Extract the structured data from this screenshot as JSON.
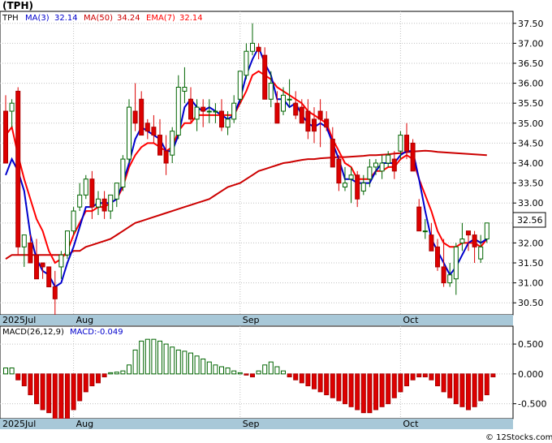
{
  "chart_data": {
    "type": "candlestick",
    "title": "(TPH)",
    "ticker": "TPH",
    "indicators": {
      "ma3": {
        "label": "MA(3)",
        "value": "32.14",
        "color": "#0000cc"
      },
      "ma50": {
        "label": "MA(50)",
        "value": "34.24",
        "color": "#cc0000"
      },
      "ema7": {
        "label": "EMA(7)",
        "value": "32.14",
        "color": "#ff0000"
      }
    },
    "price_axis": {
      "ylim": [
        30.2,
        37.8
      ],
      "ticks": [
        "37.50",
        "37.00",
        "36.50",
        "36.00",
        "35.50",
        "35.00",
        "34.50",
        "34.00",
        "33.50",
        "33.00",
        "32.50",
        "32.00",
        "31.50",
        "31.00",
        "30.50"
      ],
      "last_price_tag": "32.56"
    },
    "date_labels": [
      {
        "label": "2025Jul",
        "index": 0
      },
      {
        "label": "Aug",
        "index": 11
      },
      {
        "label": "Sep",
        "index": 38
      },
      {
        "label": "Oct",
        "index": 64
      }
    ],
    "candles": [
      [
        35.3,
        35.7,
        34.2,
        34.0
      ],
      [
        35.3,
        35.6,
        34.9,
        35.5
      ],
      [
        35.8,
        35.9,
        31.7,
        31.9
      ],
      [
        31.9,
        32.1,
        31.4,
        32.2
      ],
      [
        32.0,
        32.2,
        31.6,
        31.5
      ],
      [
        31.7,
        32.1,
        31.1,
        31.1
      ],
      [
        31.5,
        31.5,
        31.1,
        31.4
      ],
      [
        31.4,
        31.4,
        30.9,
        30.9
      ],
      [
        30.9,
        31.3,
        30.2,
        30.6
      ],
      [
        31.4,
        31.8,
        31.1,
        31.7
      ],
      [
        31.7,
        32.3,
        31.6,
        32.3
      ],
      [
        32.3,
        32.9,
        32.2,
        32.8
      ],
      [
        32.9,
        33.5,
        32.8,
        33.2
      ],
      [
        33.2,
        33.7,
        33.1,
        33.6
      ],
      [
        33.6,
        33.8,
        32.6,
        32.9
      ],
      [
        32.9,
        33.3,
        32.7,
        33.1
      ],
      [
        33.1,
        33.3,
        32.6,
        32.8
      ],
      [
        32.8,
        33.2,
        32.6,
        33.2
      ],
      [
        33.1,
        33.5,
        32.9,
        33.5
      ],
      [
        33.4,
        34.2,
        33.3,
        34.1
      ],
      [
        34.1,
        35.6,
        34.0,
        35.4
      ],
      [
        35.3,
        36.0,
        34.8,
        35.0
      ],
      [
        35.6,
        35.8,
        34.8,
        34.7
      ],
      [
        35.0,
        35.1,
        34.6,
        34.8
      ],
      [
        34.9,
        35.2,
        34.5,
        34.7
      ],
      [
        34.7,
        35.1,
        34.2,
        34.2
      ],
      [
        34.3,
        34.7,
        33.7,
        34.0
      ],
      [
        34.2,
        34.9,
        34.0,
        34.8
      ],
      [
        34.7,
        36.2,
        34.6,
        35.9
      ],
      [
        35.8,
        36.4,
        35.5,
        35.9
      ],
      [
        35.6,
        35.9,
        35.0,
        35.1
      ],
      [
        35.1,
        35.6,
        34.8,
        35.4
      ],
      [
        35.4,
        35.6,
        34.9,
        35.3
      ],
      [
        35.3,
        35.6,
        35.0,
        35.3
      ],
      [
        35.3,
        35.5,
        35.0,
        35.3
      ],
      [
        35.3,
        35.6,
        34.8,
        34.9
      ],
      [
        34.9,
        35.3,
        34.7,
        35.1
      ],
      [
        35.1,
        35.7,
        35.0,
        35.5
      ],
      [
        35.6,
        36.2,
        35.5,
        36.3
      ],
      [
        36.2,
        37.0,
        36.1,
        36.8
      ],
      [
        36.8,
        37.5,
        36.7,
        37.0
      ],
      [
        36.9,
        37.0,
        36.6,
        36.8
      ],
      [
        36.7,
        36.9,
        35.6,
        35.6
      ],
      [
        35.6,
        36.3,
        35.4,
        36.0
      ],
      [
        35.5,
        35.8,
        35.0,
        35.0
      ],
      [
        35.3,
        35.9,
        35.2,
        35.7
      ],
      [
        35.6,
        36.1,
        35.4,
        35.6
      ],
      [
        35.5,
        35.8,
        35.1,
        35.2
      ],
      [
        35.4,
        35.6,
        35.0,
        35.0
      ],
      [
        35.3,
        35.6,
        34.6,
        34.8
      ],
      [
        35.1,
        35.4,
        34.5,
        34.8
      ],
      [
        35.3,
        35.6,
        34.4,
        35.1
      ],
      [
        35.1,
        35.3,
        34.8,
        34.9
      ],
      [
        34.6,
        34.9,
        33.9,
        33.9
      ],
      [
        34.1,
        34.2,
        33.3,
        33.5
      ],
      [
        33.4,
        33.9,
        33.3,
        33.5
      ],
      [
        33.6,
        33.9,
        33.0,
        33.7
      ],
      [
        33.7,
        33.8,
        32.9,
        33.1
      ],
      [
        33.3,
        33.7,
        33.2,
        33.5
      ],
      [
        33.6,
        34.1,
        33.4,
        33.9
      ],
      [
        33.9,
        34.1,
        33.7,
        34.0
      ],
      [
        33.8,
        34.2,
        33.6,
        34.0
      ],
      [
        34.0,
        34.3,
        33.9,
        34.2
      ],
      [
        34.1,
        34.3,
        33.6,
        33.8
      ],
      [
        34.3,
        34.8,
        34.1,
        34.7
      ],
      [
        34.7,
        35.0,
        34.1,
        34.3
      ],
      [
        34.5,
        34.6,
        33.8,
        33.8
      ],
      [
        32.9,
        33.1,
        32.3,
        32.3
      ],
      [
        32.3,
        32.6,
        32.1,
        32.3
      ],
      [
        32.2,
        32.5,
        31.9,
        31.8
      ],
      [
        31.9,
        32.1,
        31.3,
        31.4
      ],
      [
        31.4,
        32.1,
        30.9,
        31.0
      ],
      [
        31.0,
        31.5,
        30.9,
        31.2
      ],
      [
        31.1,
        32.0,
        30.7,
        31.9
      ],
      [
        32.0,
        32.5,
        31.8,
        32.1
      ],
      [
        32.3,
        32.3,
        31.8,
        32.2
      ],
      [
        32.2,
        32.3,
        31.5,
        31.9
      ],
      [
        31.6,
        32.2,
        31.5,
        31.9
      ],
      [
        32.1,
        32.5,
        32.0,
        32.5
      ]
    ],
    "moving_averages": {
      "ema7": [
        34.7,
        34.9,
        34.2,
        33.6,
        33.1,
        32.6,
        32.3,
        31.8,
        31.5,
        31.6,
        31.8,
        32.2,
        32.5,
        32.8,
        32.8,
        32.9,
        32.9,
        33.0,
        33.1,
        33.4,
        33.9,
        34.2,
        34.4,
        34.5,
        34.5,
        34.4,
        34.3,
        34.4,
        34.8,
        35.0,
        35.0,
        35.2,
        35.2,
        35.2,
        35.2,
        35.2,
        35.2,
        35.2,
        35.5,
        35.8,
        36.2,
        36.3,
        36.2,
        36.1,
        35.9,
        35.8,
        35.7,
        35.6,
        35.5,
        35.3,
        35.2,
        35.1,
        35.0,
        34.6,
        34.3,
        34.0,
        33.9,
        33.6,
        33.6,
        33.6,
        33.8,
        33.8,
        33.9,
        33.9,
        34.1,
        34.2,
        34.1,
        33.6,
        33.2,
        32.8,
        32.3,
        32.0,
        31.9,
        31.9,
        32.0,
        32.0,
        32.0,
        31.9,
        32.1
      ],
      "ma3": [
        33.7,
        34.1,
        33.8,
        33.3,
        32.2,
        31.6,
        31.3,
        31.2,
        30.9,
        31.0,
        31.5,
        31.9,
        32.4,
        32.9,
        32.9,
        33.0,
        33.0,
        33.0,
        33.1,
        33.5,
        34.0,
        34.6,
        34.9,
        34.8,
        34.7,
        34.6,
        34.3,
        34.3,
        34.7,
        35.4,
        35.6,
        35.4,
        35.3,
        35.4,
        35.3,
        35.2,
        35.1,
        35.2,
        35.6,
        36.2,
        36.6,
        36.9,
        36.5,
        36.2,
        35.6,
        35.6,
        35.4,
        35.5,
        35.2,
        35.0,
        34.9,
        35.0,
        34.9,
        34.5,
        34.1,
        33.6,
        33.6,
        33.5,
        33.5,
        33.5,
        33.8,
        34.0,
        34.0,
        34.0,
        34.2,
        34.3,
        34.3,
        33.6,
        32.8,
        32.1,
        31.8,
        31.5,
        31.2,
        31.4,
        31.7,
        32.0,
        32.1,
        32.0,
        32.1
      ],
      "ma50": [
        31.6,
        31.7,
        31.7,
        31.7,
        31.7,
        31.7,
        31.7,
        31.7,
        31.7,
        31.7,
        31.7,
        31.8,
        31.8,
        31.9,
        31.95,
        32.0,
        32.05,
        32.1,
        32.2,
        32.3,
        32.4,
        32.5,
        32.55,
        32.6,
        32.65,
        32.7,
        32.75,
        32.8,
        32.85,
        32.9,
        32.95,
        33.0,
        33.05,
        33.1,
        33.2,
        33.3,
        33.4,
        33.45,
        33.5,
        33.6,
        33.7,
        33.8,
        33.85,
        33.9,
        33.95,
        34.0,
        34.02,
        34.05,
        34.08,
        34.1,
        34.1,
        34.12,
        34.13,
        34.14,
        34.15,
        34.15,
        34.16,
        34.17,
        34.18,
        34.2,
        34.2,
        34.21,
        34.22,
        34.24,
        34.25,
        34.27,
        34.29,
        34.3,
        34.31,
        34.3,
        34.28,
        34.27,
        34.26,
        34.25,
        34.24,
        34.23,
        34.22,
        34.21,
        34.2
      ]
    },
    "macd": {
      "label": "MACD(26,12,9)",
      "value_label": "MACD:-0.049",
      "ylim": [
        -0.75,
        0.8
      ],
      "ticks": [
        "0.500",
        "0.000",
        "-0.500"
      ],
      "histogram": [
        0.1,
        0.1,
        -0.1,
        -0.2,
        -0.35,
        -0.5,
        -0.6,
        -0.65,
        -0.8,
        -0.82,
        -0.75,
        -0.6,
        -0.45,
        -0.3,
        -0.2,
        -0.15,
        -0.05,
        0.02,
        0.03,
        0.05,
        0.15,
        0.4,
        0.55,
        0.58,
        0.58,
        0.55,
        0.5,
        0.45,
        0.4,
        0.38,
        0.35,
        0.3,
        0.25,
        0.2,
        0.15,
        0.12,
        0.1,
        0.05,
        0.02,
        -0.02,
        -0.05,
        0.05,
        0.15,
        0.2,
        0.12,
        0.05,
        -0.05,
        -0.1,
        -0.15,
        -0.2,
        -0.25,
        -0.3,
        -0.35,
        -0.4,
        -0.45,
        -0.5,
        -0.55,
        -0.6,
        -0.65,
        -0.65,
        -0.6,
        -0.55,
        -0.5,
        -0.4,
        -0.3,
        -0.2,
        -0.1,
        -0.05,
        -0.05,
        -0.1,
        -0.2,
        -0.3,
        -0.4,
        -0.5,
        -0.55,
        -0.6,
        -0.55,
        -0.45,
        -0.35,
        -0.05
      ]
    },
    "colors": {
      "up": "#ffffff",
      "up_border": "#006400",
      "down": "#dd0000",
      "date_bar": "#a8c8d8",
      "grid": "#c0c0c0"
    },
    "watermark": "© 12Stocks.com"
  }
}
